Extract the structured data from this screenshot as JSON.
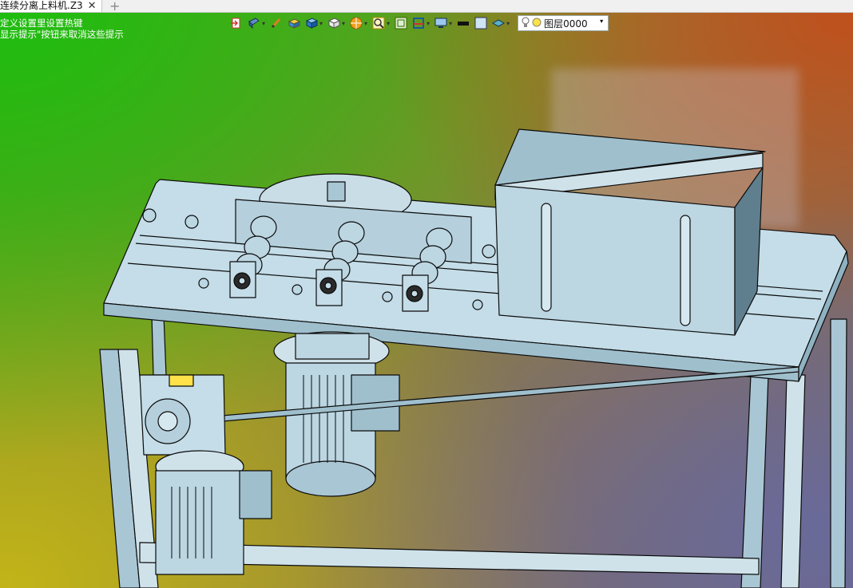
{
  "tabs": [
    {
      "label": "连续分离上料机.Z3",
      "active": true
    }
  ],
  "hints": [
    "定义设置里设置热键",
    "显示提示\"按钮来取消这些提示"
  ],
  "toolbar": {
    "items": [
      {
        "name": "exit-icon",
        "has_menu": false
      },
      {
        "name": "view-icon",
        "has_menu": true
      },
      {
        "name": "pencil-icon",
        "has_menu": false
      },
      {
        "name": "box-yellow-icon",
        "has_menu": false
      },
      {
        "name": "box-blue-icon",
        "has_menu": true
      },
      {
        "name": "cube-icon",
        "has_menu": true
      },
      {
        "name": "wheel-icon",
        "has_menu": true
      },
      {
        "name": "zoom-icon",
        "has_menu": true
      },
      {
        "name": "fit-icon",
        "has_menu": false
      },
      {
        "name": "section-icon",
        "has_menu": true
      },
      {
        "name": "monitor-icon",
        "has_menu": true
      },
      {
        "name": "line-color-icon",
        "has_menu": false
      },
      {
        "name": "fill-color-icon",
        "has_menu": false
      },
      {
        "name": "layer-style-icon",
        "has_menu": true
      }
    ],
    "layer_select": {
      "value": "图层0000"
    }
  },
  "colors": {
    "model_face": "#bcd6e2",
    "model_face_dark": "#8fb2c2",
    "model_edge": "#0a0a0a",
    "accent_yellow": "#ffe24a"
  }
}
